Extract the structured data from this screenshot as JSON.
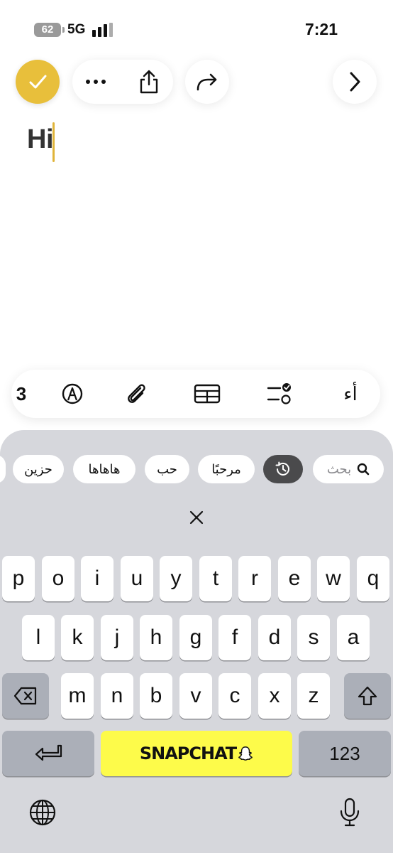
{
  "status_bar": {
    "battery": "62",
    "network": "5G",
    "time": "7:21"
  },
  "toolbar": {
    "done_icon": "checkmark-icon",
    "more_icon": "ellipsis-icon",
    "share_icon": "share-icon",
    "redo_icon": "redo-icon",
    "forward_icon": "chevron-right-icon"
  },
  "note": {
    "text": "Hi"
  },
  "format_bar": {
    "items": [
      {
        "name": "partial-icon",
        "glyph": "3"
      },
      {
        "name": "markup-icon"
      },
      {
        "name": "attachment-icon"
      },
      {
        "name": "table-icon"
      },
      {
        "name": "checklist-icon"
      },
      {
        "name": "text-format",
        "label": "أء"
      }
    ]
  },
  "keyboard": {
    "suggestions": [
      {
        "label": "حزين"
      },
      {
        "label": "هاهاها"
      },
      {
        "label": "حب"
      },
      {
        "label": "مرحبًا"
      },
      {
        "label": "recent-icon"
      },
      {
        "label": "بحث"
      }
    ],
    "row1": [
      "p",
      "o",
      "i",
      "u",
      "y",
      "t",
      "r",
      "e",
      "w",
      "q"
    ],
    "row2": [
      "l",
      "k",
      "j",
      "h",
      "g",
      "f",
      "d",
      "s",
      "a"
    ],
    "row3": [
      "m",
      "n",
      "b",
      "v",
      "c",
      "x",
      "z"
    ],
    "space_label": "SNAPCHAT",
    "numbers_label": "123",
    "accent": "#fdfb4a",
    "done_color": "#e8bf3b"
  }
}
